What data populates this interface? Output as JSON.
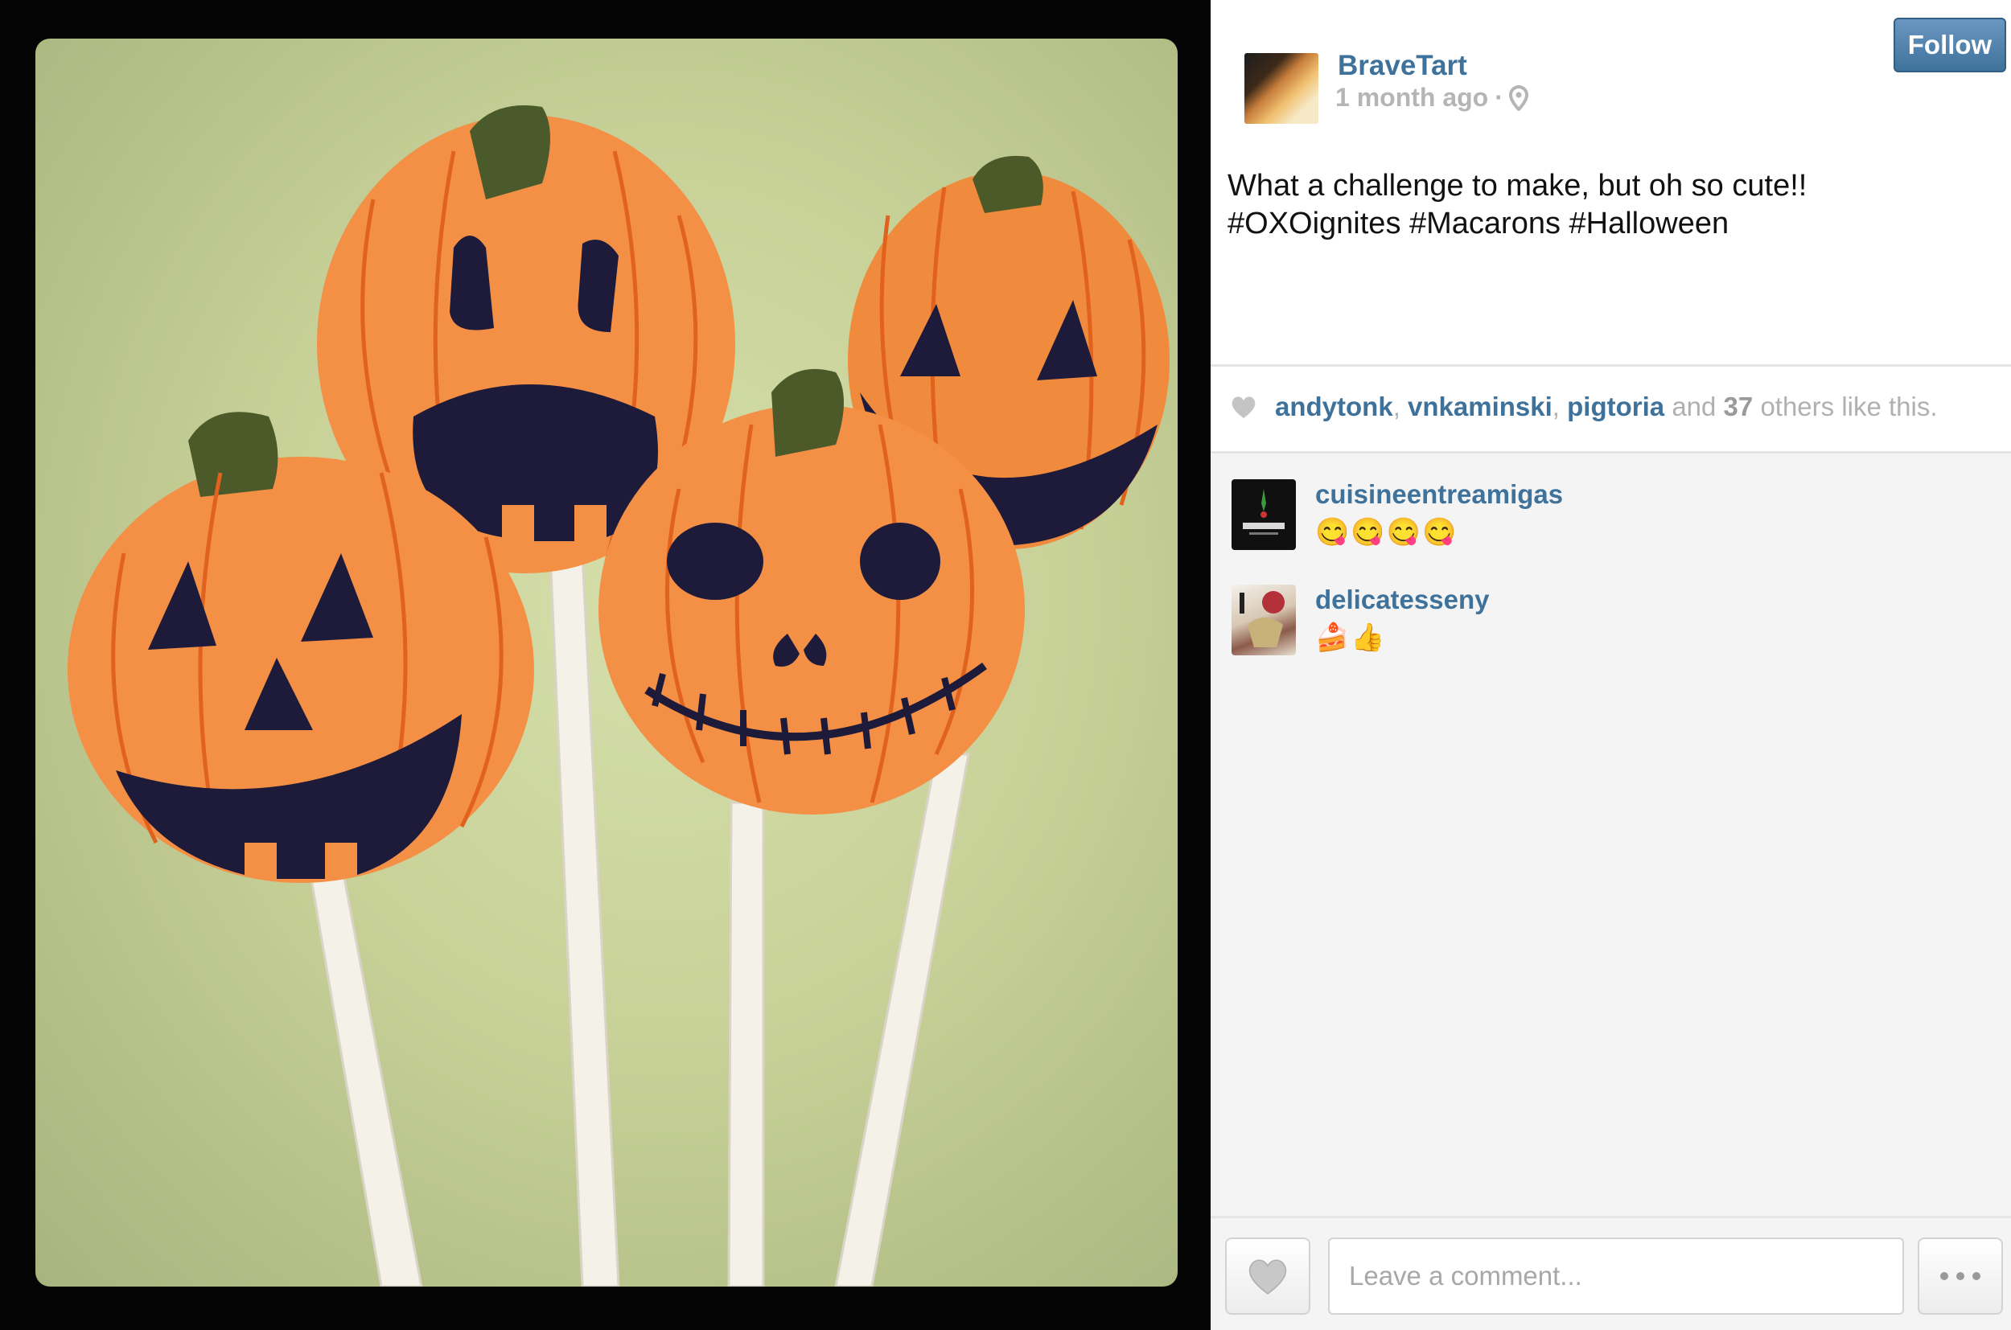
{
  "post": {
    "username": "BraveTart",
    "time": "1 month ago",
    "separator": "·",
    "follow_label": "Follow",
    "caption_line1": "What a challenge to make, but oh so cute!!",
    "caption_line2": "#OXOignites #Macarons #Halloween"
  },
  "likes": {
    "users": [
      "andytonk",
      "vnkaminski",
      "pigtoria"
    ],
    "comma": ",",
    "and_text": "and",
    "count": "37",
    "suffix": "others like this."
  },
  "comments": [
    {
      "username": "cuisineentreamigas",
      "text": "😋😋😋😋"
    },
    {
      "username": "delicatesseny",
      "text": "🍰👍"
    }
  ],
  "comment_box": {
    "placeholder": "Leave a comment..."
  },
  "icons": {
    "location": "location-pin-icon",
    "heart": "heart-icon",
    "more": "more-dots-icon"
  },
  "colors": {
    "username_blue": "#3f729b",
    "follow_button": "#3f729b",
    "muted_gray": "#b5b5b5"
  }
}
